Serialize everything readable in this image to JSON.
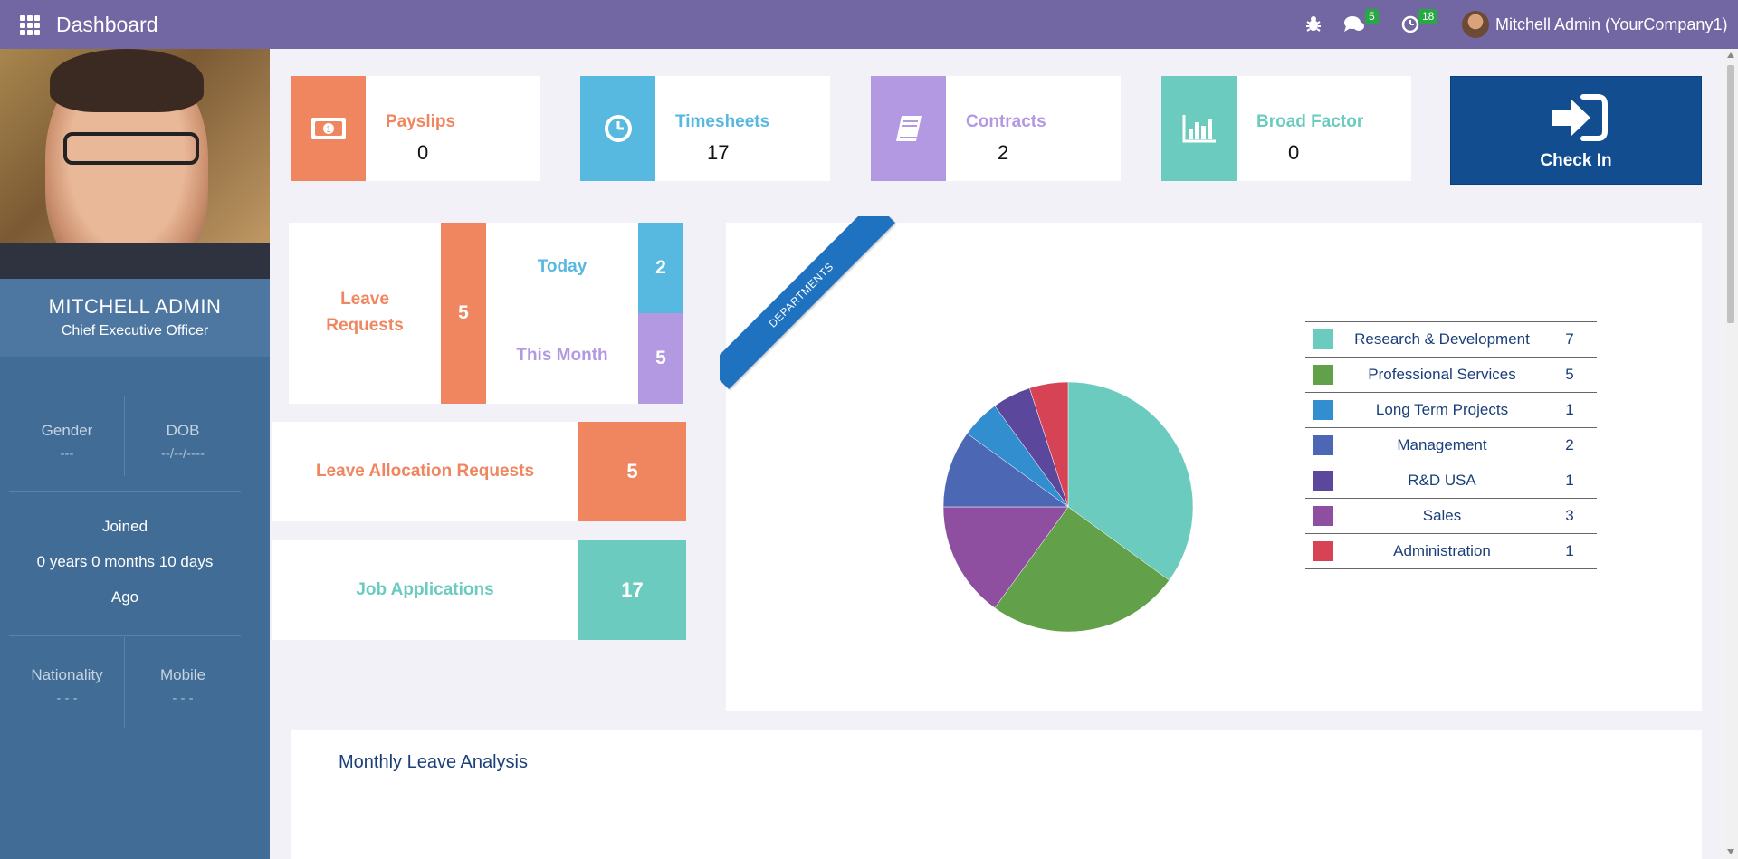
{
  "navbar": {
    "title": "Dashboard",
    "messages_badge": "5",
    "activities_badge": "18",
    "user_name": "Mitchell Admin (YourCompany1)"
  },
  "profile": {
    "name": "MITCHELL ADMIN",
    "job_title": "Chief Executive Officer",
    "gender_label": "Gender",
    "gender_value": "---",
    "dob_label": "DOB",
    "dob_value": "--/--/----",
    "joined_label": "Joined",
    "joined_value": "0 years 0 months 10 days",
    "joined_suffix": "Ago",
    "nationality_label": "Nationality",
    "nationality_value": "- - -",
    "mobile_label": "Mobile",
    "mobile_value": "- - -"
  },
  "stats": [
    {
      "label": "Payslips",
      "value": "0",
      "color": "#f0865f",
      "icon": "money-icon"
    },
    {
      "label": "Timesheets",
      "value": "17",
      "color": "#57b8e0",
      "icon": "clock-icon"
    },
    {
      "label": "Contracts",
      "value": "2",
      "color": "#b399e2",
      "icon": "book-icon"
    },
    {
      "label": "Broad Factor",
      "value": "0",
      "color": "#6ccbbf",
      "icon": "bar-chart-icon"
    }
  ],
  "checkin": {
    "label": "Check In",
    "color": "#124d8f"
  },
  "leave_requests": {
    "label_line1": "Leave",
    "label_line2": "Requests",
    "total": "5",
    "today_label": "Today",
    "today_value": "2",
    "month_label": "This Month",
    "month_value": "5"
  },
  "leave_allocation": {
    "label": "Leave Allocation Requests",
    "value": "5"
  },
  "job_applications": {
    "label": "Job Applications",
    "value": "17"
  },
  "departments": {
    "ribbon_label": "DEPARTMENTS",
    "items": [
      {
        "name": "Research & Development",
        "count": "7",
        "color": "#6ccbbf"
      },
      {
        "name": "Professional Services",
        "count": "5",
        "color": "#62a049"
      },
      {
        "name": "Long Term Projects",
        "count": "1",
        "color": "#338ecf"
      },
      {
        "name": "Management",
        "count": "2",
        "color": "#4c68b4"
      },
      {
        "name": "R&D USA",
        "count": "1",
        "color": "#5b489c"
      },
      {
        "name": "Sales",
        "count": "3",
        "color": "#8e4fa0"
      },
      {
        "name": "Administration",
        "count": "1",
        "color": "#d54354"
      }
    ]
  },
  "chart_data": {
    "type": "pie",
    "categories": [
      "Research & Development",
      "Professional Services",
      "Sales",
      "Management",
      "Long Term Projects",
      "R&D USA",
      "Administration"
    ],
    "values": [
      7,
      5,
      3,
      2,
      1,
      1,
      1
    ],
    "colors": [
      "#6ccbbf",
      "#62a049",
      "#8e4fa0",
      "#4c68b4",
      "#338ecf",
      "#5b489c",
      "#d54354"
    ]
  },
  "monthly": {
    "title": "Monthly Leave Analysis"
  }
}
